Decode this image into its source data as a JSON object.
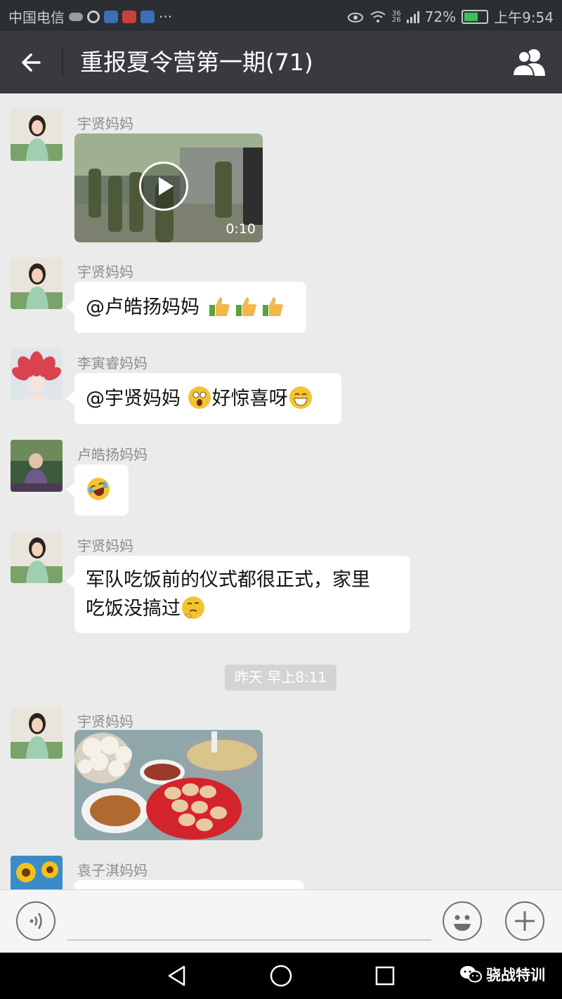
{
  "status_bar": {
    "carrier": "中国电信",
    "battery": "72%",
    "battery_level": 0.72,
    "network": "36\n26",
    "time": "上午9:54"
  },
  "header": {
    "title": "重报夏令营第一期(71)"
  },
  "messages": [
    {
      "sender": "宇贤妈妈",
      "type": "video",
      "duration": "0:10"
    },
    {
      "sender": "宇贤妈妈",
      "type": "text",
      "text": "@卢皓扬妈妈 "
    },
    {
      "sender": "李寅睿妈妈",
      "type": "text",
      "text_a": "@宇贤妈妈 ",
      "text_b": "好惊喜呀"
    },
    {
      "sender": "卢皓扬妈妈",
      "type": "emoji"
    },
    {
      "sender": "宇贤妈妈",
      "type": "text",
      "line1": "军队吃饭前的仪式都很正式，家里",
      "line2": "吃饭没搞过"
    },
    {
      "sender": "宇贤妈妈",
      "type": "image"
    },
    {
      "sender": "袁子淇妈妈",
      "type": "text"
    }
  ],
  "timestamp": "昨天 早上8:11",
  "watermark": "骁战特训",
  "icons": {
    "back": "arrow-left-icon",
    "members": "group-members-icon",
    "voice": "voice-icon",
    "emoji": "smiley-icon",
    "plus": "plus-icon",
    "nav_back": "triangle-back-icon",
    "nav_home": "circle-home-icon",
    "nav_recent": "square-recent-icon"
  },
  "colors": {
    "title_bar": "#393a3f",
    "status_bar": "#2b2e33",
    "chat_bg": "#ebebeb",
    "bubble": "#ffffff"
  }
}
